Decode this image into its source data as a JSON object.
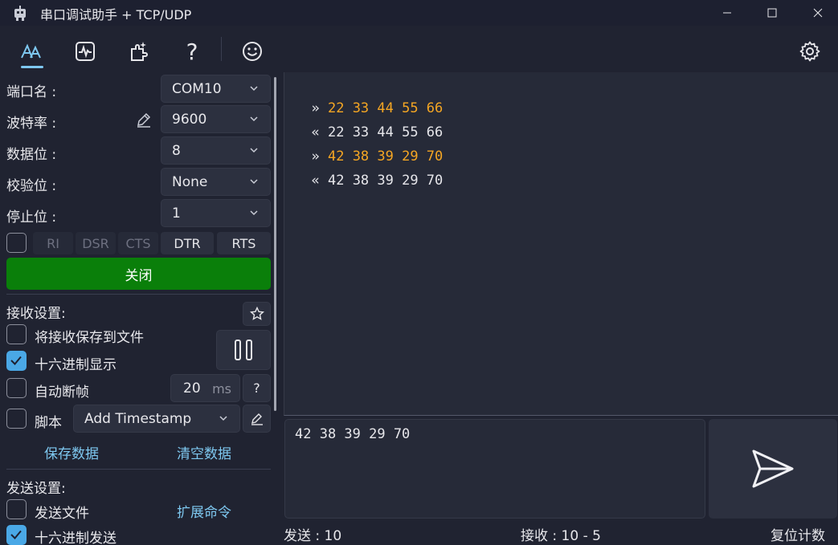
{
  "window": {
    "title": "串口调试助手 + TCP/UDP"
  },
  "toolbar": {
    "icons": [
      "serial-icon",
      "waveform-icon",
      "plugin-icon",
      "help-icon",
      "smiley-icon",
      "settings-icon"
    ],
    "help_glyph": "?"
  },
  "serial": {
    "port_label": "端口名 :",
    "port_value": "COM10",
    "baud_label": "波特率 :",
    "baud_value": "9600",
    "databits_label": "数据位 :",
    "databits_value": "8",
    "parity_label": "校验位 :",
    "parity_value": "None",
    "stopbits_label": "停止位 :",
    "stopbits_value": "1",
    "signals": [
      "RI",
      "DSR",
      "CTS",
      "DTR",
      "RTS"
    ],
    "close_label": "关闭"
  },
  "receive": {
    "section_label": "接收设置:",
    "save_to_file_label": "将接收保存到文件",
    "hex_display_label": "十六进制显示",
    "auto_frame_label": "自动断帧",
    "auto_frame_value": "20",
    "auto_frame_unit": "ms",
    "auto_frame_help": "?",
    "script_label": "脚本",
    "script_value": "Add Timestamp",
    "save_data_label": "保存数据",
    "clear_data_label": "清空数据"
  },
  "send": {
    "section_label": "发送设置:",
    "send_file_label": "发送文件",
    "extend_cmd_label": "扩展命令",
    "hex_send_label": "十六进制发送",
    "input_value": "42 38 39 29 70"
  },
  "log": [
    {
      "arrow": "»",
      "data": "22 33 44 55 66",
      "dir": "tx"
    },
    {
      "arrow": "«",
      "data": "22 33 44 55 66",
      "dir": "rx"
    },
    {
      "arrow": "»",
      "data": "42 38 39 29 70",
      "dir": "tx"
    },
    {
      "arrow": "«",
      "data": "42 38 39 29 70",
      "dir": "rx"
    }
  ],
  "status": {
    "sent_label": "发送 : 10",
    "recv_label": "接收 :  10  -  5",
    "reset_label": "复位计数"
  },
  "colors": {
    "tx": "#f5a623",
    "rx": "#e6e6ea",
    "accent": "#7ec8f0",
    "close_button": "#0a7f0a"
  }
}
